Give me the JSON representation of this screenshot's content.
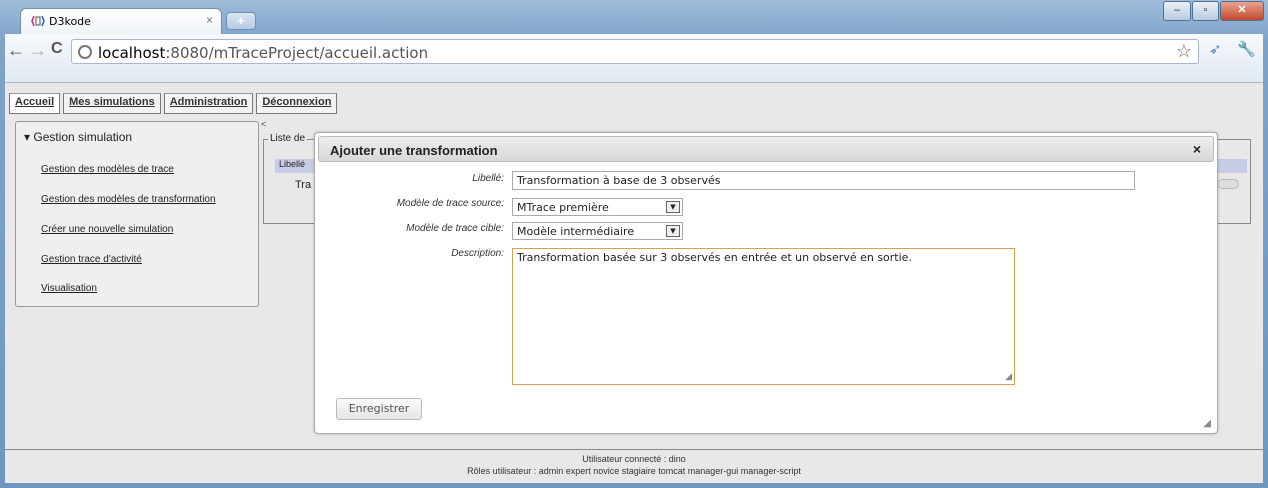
{
  "browser": {
    "tab_title": "D3kode",
    "tab_close": "×",
    "new_tab": "+",
    "url_host": "localhost",
    "url_path": ":8080/mTraceProject/accueil.action"
  },
  "menu": {
    "items": [
      "Accueil",
      "Mes simulations",
      "Administration",
      "Déconnexion"
    ]
  },
  "sidebar": {
    "title": "Gestion simulation",
    "items": [
      "Gestion des modèles de trace",
      "Gestion des modèles de transformation",
      "Créer une nouvelle simulation",
      "Gestion trace d'activité",
      "Visualisation"
    ]
  },
  "list": {
    "legend": "Liste de",
    "header": "Libellé",
    "cell": "Tra"
  },
  "dialog": {
    "title": "Ajouter une transformation",
    "close": "×",
    "labels": {
      "libelle": "Libellé:",
      "source": "Modèle de trace source:",
      "cible": "Modèle de trace cible:",
      "description": "Description:"
    },
    "libelle_value": "Transformation à base de 3 observés",
    "source_value": "MTrace première",
    "cible_value": "Modèle intermédiaire",
    "description_value": "Transformation basée sur 3 observés en entrée et un observé en sortie.",
    "save_label": "Enregistrer"
  },
  "footer": {
    "user": "Utilisateur connecté : dino",
    "roles": "Rôles utilisateur : admin expert novice stagiaire tomcat manager-gui manager-script"
  }
}
